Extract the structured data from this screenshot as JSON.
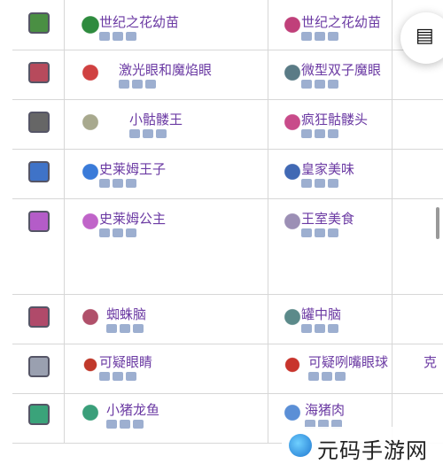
{
  "rows": [
    {
      "boss": "boss-plantera-icon",
      "c1": "世纪之花幼苗",
      "c2": "世纪之花幼苗",
      "edge": "partial-item"
    },
    {
      "boss": "boss-twins-icon",
      "c1": "激光眼和魔焰眼",
      "c2": "微型双子魔眼",
      "edge": "partial-item"
    },
    {
      "boss": "boss-skeletron-icon",
      "c1": "小骷髅王",
      "c2": "疯狂骷髅头",
      "edge": "partial-item"
    },
    {
      "boss": "boss-king-slime-icon",
      "c1": "史莱姆王子",
      "c2": "皇家美味",
      "edge": "partial-item"
    },
    {
      "boss": "boss-queen-slime-icon",
      "c1": "史莱姆公主",
      "c2": "王室美食",
      "edge": "partial-item"
    },
    {
      "boss": "boss-brain-icon",
      "c1": "蜘蛛脑",
      "c2": "罐中脑",
      "edge": "partial-item"
    },
    {
      "boss": "boss-eye-icon",
      "c1": "可疑眼睛",
      "c2": "可疑咧嘴眼球",
      "edge": "partial-item",
      "edge_text": "克"
    },
    {
      "boss": "boss-duke-fishron-icon",
      "c1": "小猪龙鱼",
      "c2": "海猪肉",
      "edge": "partial-item"
    }
  ],
  "fab": {
    "icon": "document-list-icon",
    "glyph": "▤"
  },
  "watermark": {
    "text": "元码手游网"
  },
  "colors": {
    "item_name": "#6b3aa3",
    "grid": "#d7d7d7",
    "platform_icons": "#8ca1c8"
  }
}
